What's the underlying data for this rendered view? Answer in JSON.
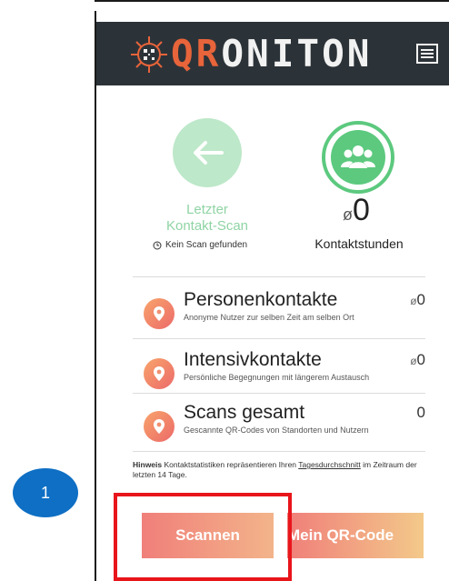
{
  "header": {
    "logo_text_accent": "QR",
    "logo_text_rest": "ONITON"
  },
  "last_scan": {
    "label_line1": "Letzter",
    "label_line2": "Kontakt-Scan",
    "status": "Kein Scan gefunden"
  },
  "contact_hours": {
    "avg_symbol": "ø",
    "value": "0",
    "label": "Kontaktstunden"
  },
  "stats": [
    {
      "title": "Personenkontakte",
      "subtitle": "Anonyme Nutzer zur selben Zeit am selben Ort",
      "avg_symbol": "ø",
      "value": "0"
    },
    {
      "title": "Intensivkontakte",
      "subtitle": "Persönliche Begegnungen mit längerem Austausch",
      "avg_symbol": "ø",
      "value": "0"
    },
    {
      "title": "Scans gesamt",
      "subtitle": "Gescannte QR-Codes von Standorten und Nutzern",
      "avg_symbol": "",
      "value": "0"
    }
  ],
  "hint": {
    "label": "Hinweis",
    "text_before": "Kontaktstatistiken repräsentieren Ihren",
    "link": "Tagesdurchschnitt",
    "text_after": "im Zeitraum der letzten 14 Tage."
  },
  "buttons": {
    "scan": "Scannen",
    "my_qr": "Mein QR-Code"
  },
  "annotation": {
    "step_number": "1"
  },
  "colors": {
    "header_bg": "#2c3338",
    "logo_accent": "#e8643a",
    "green": "#5cc97e",
    "light_green": "#bde8c9",
    "button_start": "#f07f7a",
    "button_end": "#f3b48a",
    "highlight": "#e8151b",
    "badge": "#0e6fc4"
  }
}
